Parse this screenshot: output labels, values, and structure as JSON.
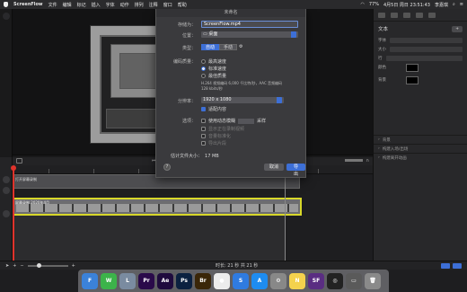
{
  "menubar": {
    "app": "ScreenFlow",
    "items": [
      "文件",
      "编辑",
      "标记",
      "插入",
      "字体",
      "动作",
      "排列",
      "注释",
      "窗口",
      "帮助"
    ],
    "battery": "77%",
    "datetime": "4月5日 周日 23:51:43",
    "user": "李嘉琪"
  },
  "sheet": {
    "title": "未命名",
    "name_label": "存储为：",
    "name_value": "ScreenFlow.mp4",
    "location_label": "位置：",
    "location_value": "桌面",
    "type_label": "类型：",
    "type_auto": "自动",
    "type_manual": "手动",
    "encoding_label": "编码质量：",
    "quality_options": [
      "最高速度",
      "标准速度",
      "最佳质量"
    ],
    "quality_selected": 1,
    "encoding_desc1": "H.264 视频编码 6,000 千比特/秒，AAC 音频编码",
    "encoding_desc2": "128 kbits/秒",
    "resolution_label": "分辨率：",
    "resolution_value": "1920 x 1080",
    "scale_label": "适配内容",
    "options_label": "选项：",
    "opt_dynamic": "使用动态模糊",
    "opt_dynamic_suffix": "采样",
    "opt_disabled": [
      "显示正在录制视频",
      "音量标准化",
      "导出片段"
    ],
    "size_label": "估计文件大小：",
    "size_value": "17 MB",
    "cancel": "取消",
    "export": "导出",
    "help": "?"
  },
  "inspector": {
    "title": "文本",
    "add": "+",
    "rows": [
      "字体",
      "大小",
      "行",
      "颜色",
      "背景"
    ],
    "sections": [
      "背景",
      "构建入场/出场",
      "构建离开动画"
    ]
  },
  "timeline": {
    "track1": "打开屏幕录制",
    "track2": "屏幕录制 2020年4月"
  },
  "bottombar": {
    "duration": "时长: 21 秒 共 21 秒"
  },
  "dock": {
    "apps": [
      {
        "name": "finder-icon",
        "label": "F",
        "color": "#3b82d9"
      },
      {
        "name": "wechat-icon",
        "label": "W",
        "color": "#3cb34a"
      },
      {
        "name": "launchpad-icon",
        "label": "L",
        "color": "#7a8ba0"
      },
      {
        "name": "premiere-icon",
        "label": "Pr",
        "color": "#2a0a4a"
      },
      {
        "name": "after-effects-icon",
        "label": "Ae",
        "color": "#1f0b3e"
      },
      {
        "name": "photoshop-icon",
        "label": "Ps",
        "color": "#0b2140"
      },
      {
        "name": "bridge-icon",
        "label": "Br",
        "color": "#3a2608"
      },
      {
        "name": "photos-icon",
        "label": "●",
        "color": "#ececec"
      },
      {
        "name": "safari-icon",
        "label": "S",
        "color": "#2f7be0"
      },
      {
        "name": "app-store-icon",
        "label": "A",
        "color": "#1e8cf0"
      },
      {
        "name": "settings-icon",
        "label": "⚙",
        "color": "#888"
      },
      {
        "name": "notes-icon",
        "label": "N",
        "color": "#f4d24d"
      },
      {
        "name": "screenflow-icon",
        "label": "SF",
        "color": "#5a2d82"
      },
      {
        "name": "obs-icon",
        "label": "◎",
        "color": "#222"
      },
      {
        "name": "finder-window-icon",
        "label": "▭",
        "color": "#5a5a5a"
      },
      {
        "name": "trash-icon",
        "label": "🗑",
        "color": "#8a8a8a"
      }
    ]
  }
}
